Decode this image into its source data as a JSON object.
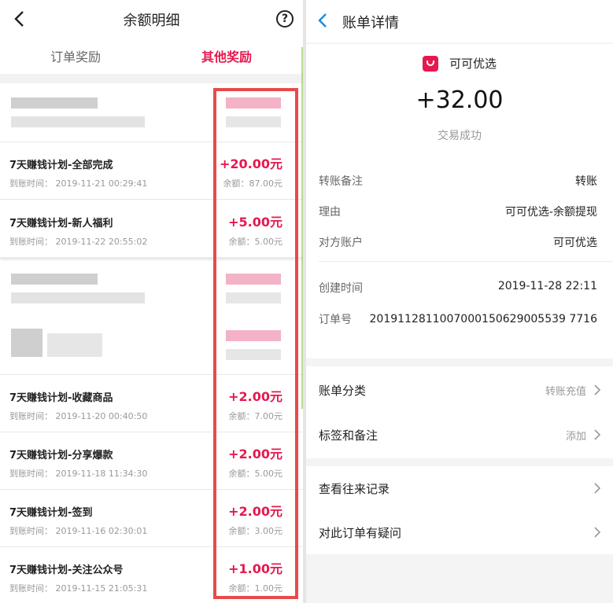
{
  "left": {
    "title": "余额明细",
    "help_glyph": "?",
    "tabs": [
      "订单奖励",
      "其他奖励"
    ],
    "rows": [
      {
        "title": "7天赚钱计划-全部完成",
        "time": "到账时间：  2019-11-21 00:29:41",
        "amount": "+20.00元",
        "balance": "余额：87.00元"
      },
      {
        "title": "7天赚钱计划-新人福利",
        "time": "到账时间：  2019-11-22 20:55:02",
        "amount": "+5.00元",
        "balance": "余额：5.00元"
      },
      {
        "title": "7天赚钱计划-收藏商品",
        "time": "到账时间：  2019-11-20 00:40:50",
        "amount": "+2.00元",
        "balance": "余额：7.00元"
      },
      {
        "title": "7天赚钱计划-分享爆款",
        "time": "到账时间：  2019-11-18 11:34:30",
        "amount": "+2.00元",
        "balance": "余额：5.00元"
      },
      {
        "title": "7天赚钱计划-签到",
        "time": "到账时间：  2019-11-16 02:30:01",
        "amount": "+2.00元",
        "balance": "余额：3.00元"
      },
      {
        "title": "7天赚钱计划-关注公众号",
        "time": "到账时间：  2019-11-15 21:05:31",
        "amount": "+1.00元",
        "balance": "余额：1.00元"
      }
    ]
  },
  "right": {
    "title": "账单详情",
    "merchant": "可可优选",
    "amount": "+32.00",
    "status": "交易成功",
    "details": [
      {
        "key": "转账备注",
        "value": "转账"
      },
      {
        "key": "理由",
        "value": "可可优选-余额提现"
      },
      {
        "key": "对方账户",
        "value": "可可优选"
      },
      {
        "key": "创建时间",
        "value": "2019-11-28 22:11"
      }
    ],
    "order_key": "订单号",
    "order_no": "2019112811007000150629005539 7716",
    "category": {
      "label": "账单分类",
      "value": "转账充值"
    },
    "tags": {
      "label": "标签和备注",
      "value": "添加"
    },
    "history": {
      "label": "查看往来记录"
    },
    "question": {
      "label": "对此订单有疑问"
    }
  },
  "colors": {
    "accent": "#e5194f",
    "highlight_box": "#e84a4a",
    "link_blue": "#1a8be0"
  }
}
